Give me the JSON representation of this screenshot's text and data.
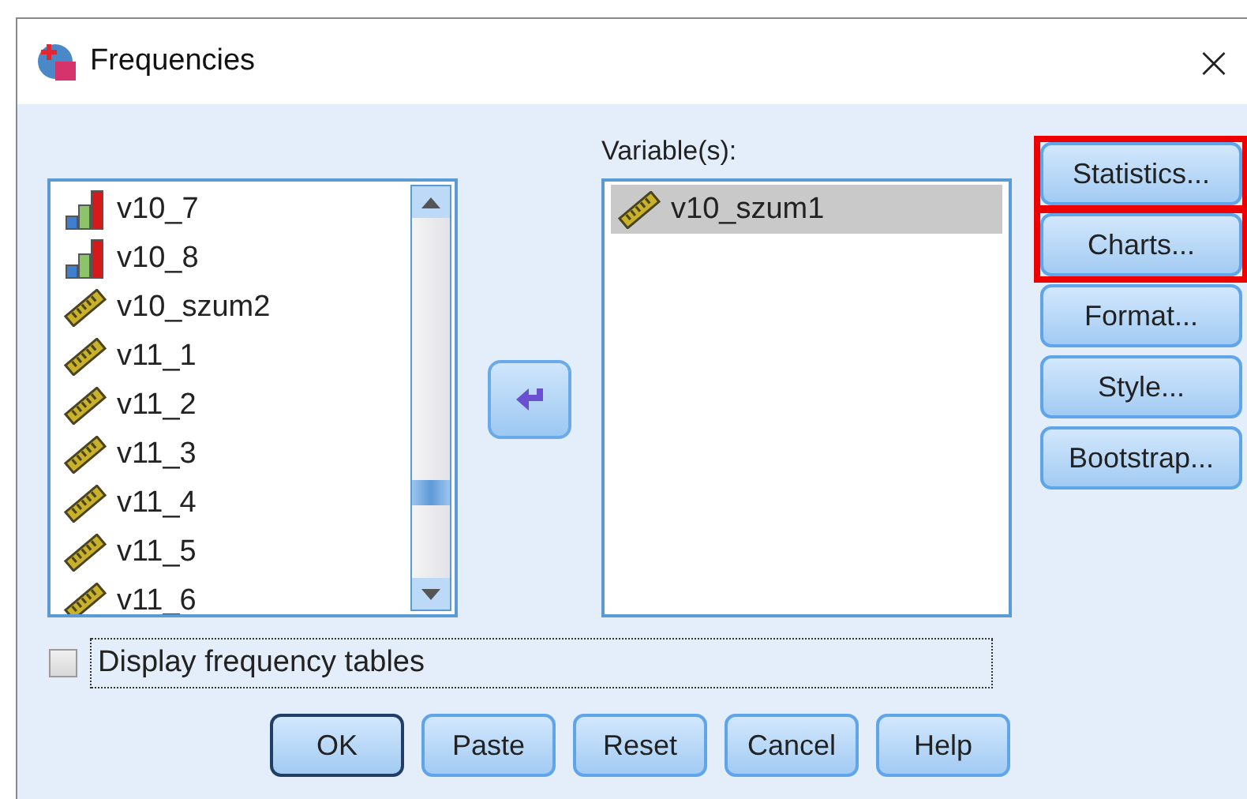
{
  "window": {
    "title": "Frequencies",
    "close": "×"
  },
  "source_list": {
    "items": [
      {
        "name": "v10_7",
        "kind": "ordinal",
        "selected": false
      },
      {
        "name": "v10_8",
        "kind": "ordinal",
        "selected": false
      },
      {
        "name": "v10_szum2",
        "kind": "scale",
        "selected": false
      },
      {
        "name": "v11_1",
        "kind": "scale",
        "selected": false
      },
      {
        "name": "v11_2",
        "kind": "scale",
        "selected": false
      },
      {
        "name": "v11_3",
        "kind": "scale",
        "selected": false
      },
      {
        "name": "v11_4",
        "kind": "scale",
        "selected": false
      },
      {
        "name": "v11_5",
        "kind": "scale",
        "selected": false
      },
      {
        "name": "v11_6",
        "kind": "scale",
        "selected": false
      }
    ]
  },
  "target_list": {
    "label": "Variable(s):",
    "items": [
      {
        "name": "v10_szum1",
        "kind": "scale",
        "selected": true
      }
    ]
  },
  "side_buttons": [
    {
      "label": "Statistics...",
      "highlighted": true
    },
    {
      "label": "Charts...",
      "highlighted": true
    },
    {
      "label": "Format...",
      "highlighted": false
    },
    {
      "label": "Style...",
      "highlighted": false
    },
    {
      "label": "Bootstrap...",
      "highlighted": false
    }
  ],
  "display_frequency_tables": {
    "label": "Display frequency tables",
    "checked": false,
    "focused": true
  },
  "buttons": [
    {
      "label": "OK",
      "default": true
    },
    {
      "label": "Paste",
      "default": false
    },
    {
      "label": "Reset",
      "default": false
    },
    {
      "label": "Cancel",
      "default": false
    },
    {
      "label": "Help",
      "default": false
    }
  ]
}
